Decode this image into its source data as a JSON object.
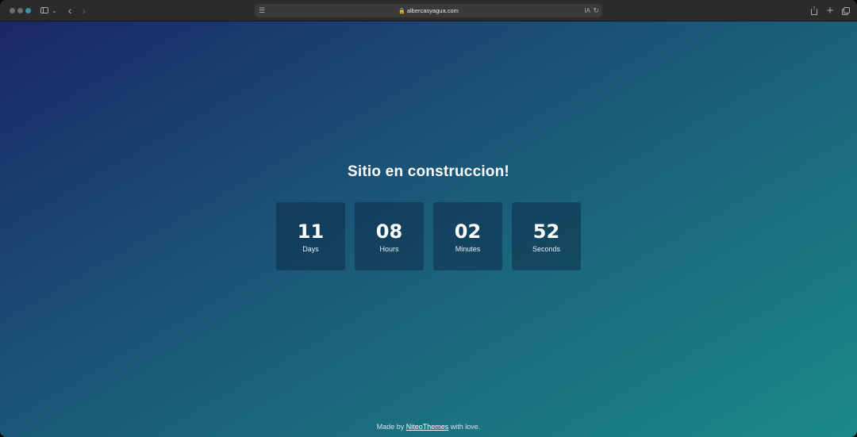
{
  "browser": {
    "url": "albercasyagua.com",
    "icons": {
      "sidebar": "sidebar-icon",
      "back": "chevron-left-icon",
      "forward": "chevron-right-icon",
      "page_menu": "page-menu-icon",
      "lock": "lock-icon",
      "translate": "translate-icon",
      "reload": "reload-icon",
      "share": "share-icon",
      "new_tab": "plus-icon",
      "tab_overview": "tab-overview-icon"
    }
  },
  "page": {
    "title": "Sitio en construccion!",
    "countdown": [
      {
        "value": "11",
        "label": "Days"
      },
      {
        "value": "08",
        "label": "Hours"
      },
      {
        "value": "02",
        "label": "Minutes"
      },
      {
        "value": "52",
        "label": "Seconds"
      }
    ],
    "footer": {
      "prefix": "Made by ",
      "link_text": "NiteoThemes",
      "suffix": " with love."
    },
    "colors": {
      "gradient_start": "#1a2766",
      "gradient_end": "#1b8a86"
    }
  }
}
